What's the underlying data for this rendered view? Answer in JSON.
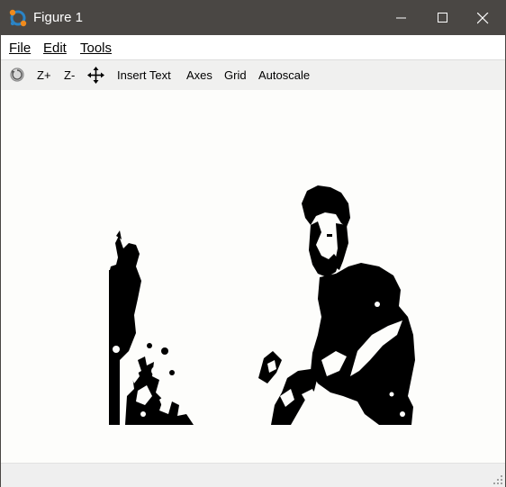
{
  "window": {
    "title": "Figure 1"
  },
  "menu": {
    "file_label": "File",
    "edit_label": "Edit",
    "tools_label": "Tools"
  },
  "toolbar": {
    "zoom_in_label": "Z+",
    "zoom_out_label": "Z-",
    "insert_text_label": "Insert Text",
    "axes_label": "Axes",
    "grid_label": "Grid",
    "autoscale_label": "Autoscale",
    "icons": [
      "rotate-icon",
      "pan-icon"
    ]
  },
  "figure": {
    "image": "binary black-and-white thresholded image",
    "colors": {
      "foreground": "#000000",
      "background": "#fdfdfb"
    }
  },
  "theme": {
    "titlebar": "#4a4744",
    "toolbar": "#f0f0ef",
    "statusbar": "#efefef"
  }
}
